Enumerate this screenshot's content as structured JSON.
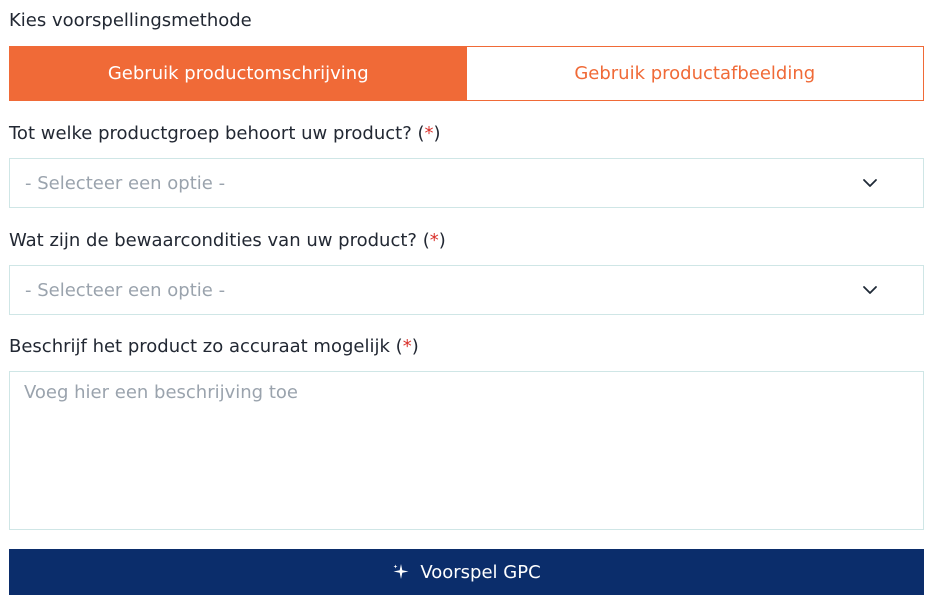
{
  "method": {
    "heading": "Kies voorspellingsmethode",
    "options": [
      {
        "label": "Gebruik productomschrijving",
        "active": true
      },
      {
        "label": "Gebruik productafbeelding",
        "active": false
      }
    ]
  },
  "fields": {
    "product_group": {
      "label": "Tot welke productgroep behoort uw product?",
      "required_mark": "*",
      "placeholder": "- Selecteer een optie -"
    },
    "storage": {
      "label": "Wat zijn de bewaarcondities van uw product?",
      "required_mark": "*",
      "placeholder": "- Selecteer een optie -"
    },
    "description": {
      "label": "Beschrijf het product zo accuraat mogelijk",
      "required_mark": "*",
      "placeholder": "Voeg hier een beschrijving toe",
      "value": ""
    }
  },
  "action": {
    "label": "Voorspel GPC",
    "icon": "sparkle-icon"
  },
  "colors": {
    "accent_orange": "#f06a37",
    "primary_navy": "#0b2d6b",
    "required_red": "#d9312b",
    "input_border": "#cfe6e6",
    "placeholder_gray": "#9aa3ad"
  }
}
